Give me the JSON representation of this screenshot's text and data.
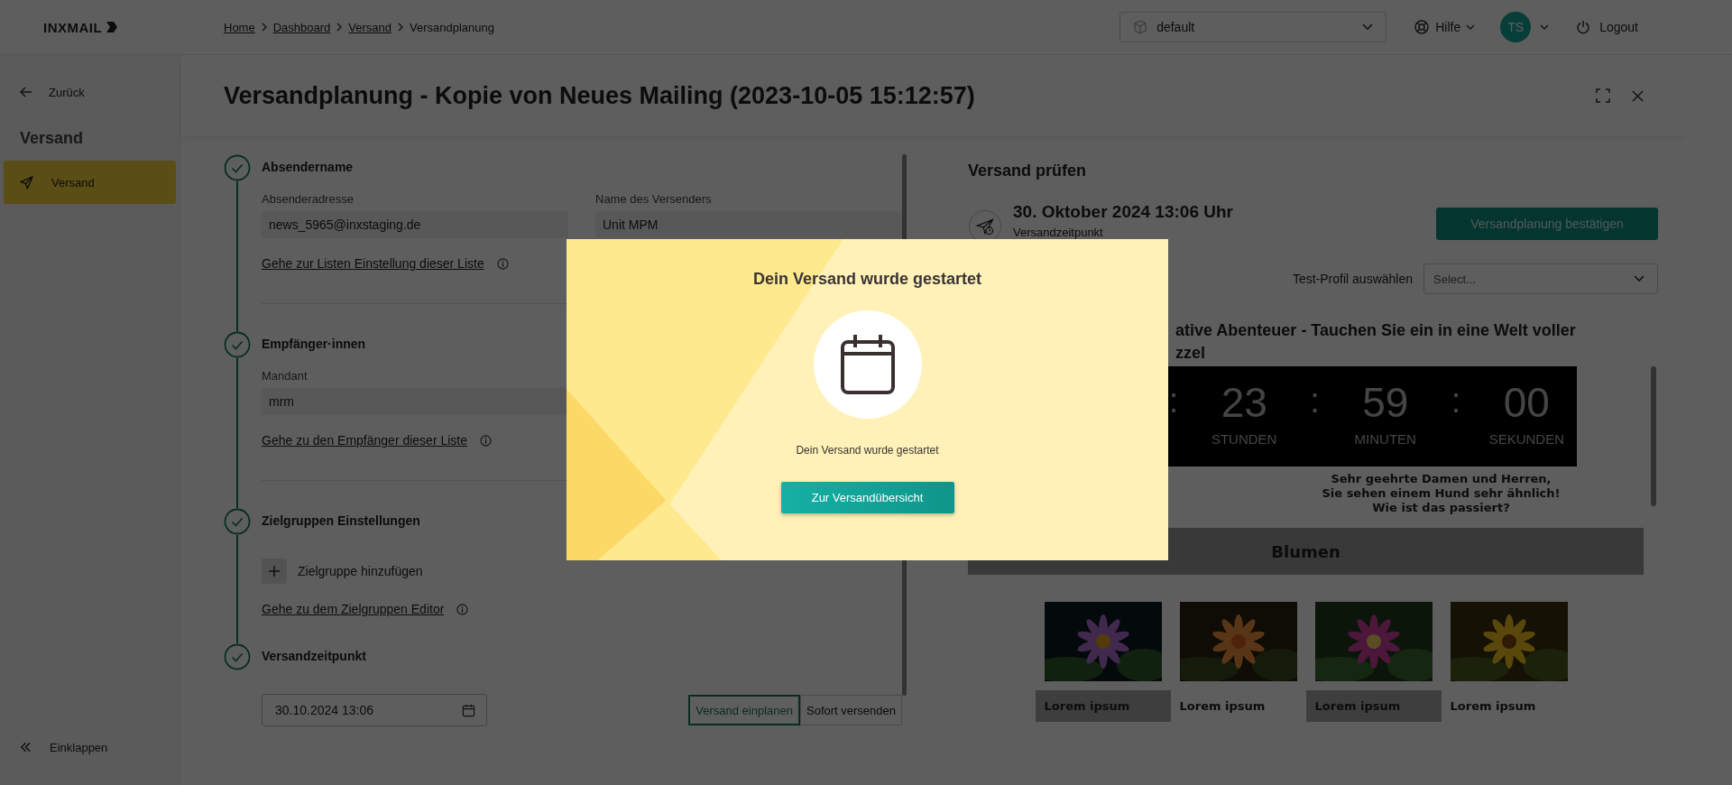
{
  "topbar": {
    "logo": "INXMAIL",
    "breadcrumb": [
      {
        "label": "Home",
        "link": true
      },
      {
        "label": "Dashboard",
        "link": true
      },
      {
        "label": "Versand",
        "link": true
      },
      {
        "label": "Versandplanung",
        "link": false
      }
    ],
    "workspace": "default",
    "help": "Hilfe",
    "avatar": "TS",
    "logout": "Logout"
  },
  "sidebar": {
    "back": "Zurück",
    "section": "Versand",
    "items": [
      {
        "label": "Versand",
        "selected": true
      }
    ],
    "collapse": "Einklappen"
  },
  "title": "Versandplanung - Kopie von Neues Mailing (2023-10-05 15:12:57)",
  "steps": [
    {
      "kind": "fields",
      "title": "Absendername",
      "completed": true,
      "fields": [
        {
          "label": "Absenderadresse",
          "value": "news_5965@inxstaging.de"
        },
        {
          "label": "Name des Versenders",
          "value": "Unit MPM"
        }
      ],
      "link": "Gehe zur Listen Einstellung dieser Liste"
    },
    {
      "kind": "fields",
      "title": "Empfänger·innen",
      "completed": true,
      "fields": [
        {
          "label": "Mandant",
          "value": "mrm"
        }
      ],
      "link": "Gehe zu den Empfänger dieser Liste"
    },
    {
      "kind": "groups",
      "title": "Zielgruppen Einstellungen",
      "completed": true,
      "add": "Zielgruppe hinzufügen",
      "link": "Gehe zu dem Zielgruppen Editor"
    },
    {
      "kind": "schedule",
      "title": "Versandzeitpunkt",
      "completed": true,
      "date": "30.10.2024 13:06",
      "modes": [
        {
          "label": "Versand einplanen",
          "selected": true
        },
        {
          "label": "Sofort versenden",
          "selected": false
        }
      ]
    }
  ],
  "review": {
    "title": "Versand prüfen",
    "date": "30. Oktober 2024 13:06 Uhr",
    "date_label": "Versandzeitpunkt",
    "confirm": "Versandplanung bestätigen",
    "profile_label": "Test-Profil auswählen",
    "profile_placeholder": "Select...",
    "preview": {
      "heading": [
        "ative Abenteuer - Tauchen Sie ein in eine Welt voller",
        "zzel"
      ],
      "countdown": [
        {
          "separator": ":",
          "value": "23",
          "unit": "STUNDEN"
        },
        {
          "separator": ":",
          "value": "59",
          "unit": "MINUTEN"
        },
        {
          "separator": ":",
          "value": "00",
          "unit": "SEKUNDEN"
        }
      ],
      "greeting": [
        "Sehr geehrte Damen und Herren,",
        "Sie sehen einem Hund sehr ähnlich!",
        "Wie ist das passiert?"
      ],
      "section": "Blumen",
      "products": [
        {
          "caption": "Lorem ipsum",
          "highlighted": true
        },
        {
          "caption": "Lorem ipsum",
          "highlighted": false
        },
        {
          "caption": "Lorem ipsum",
          "highlighted": true
        },
        {
          "caption": "Lorem ipsum",
          "highlighted": false
        }
      ]
    }
  },
  "modal": {
    "title": "Dein Versand wurde gestartet",
    "message": "Dein Versand wurde gestartet",
    "button": "Zur Versandübersicht"
  }
}
